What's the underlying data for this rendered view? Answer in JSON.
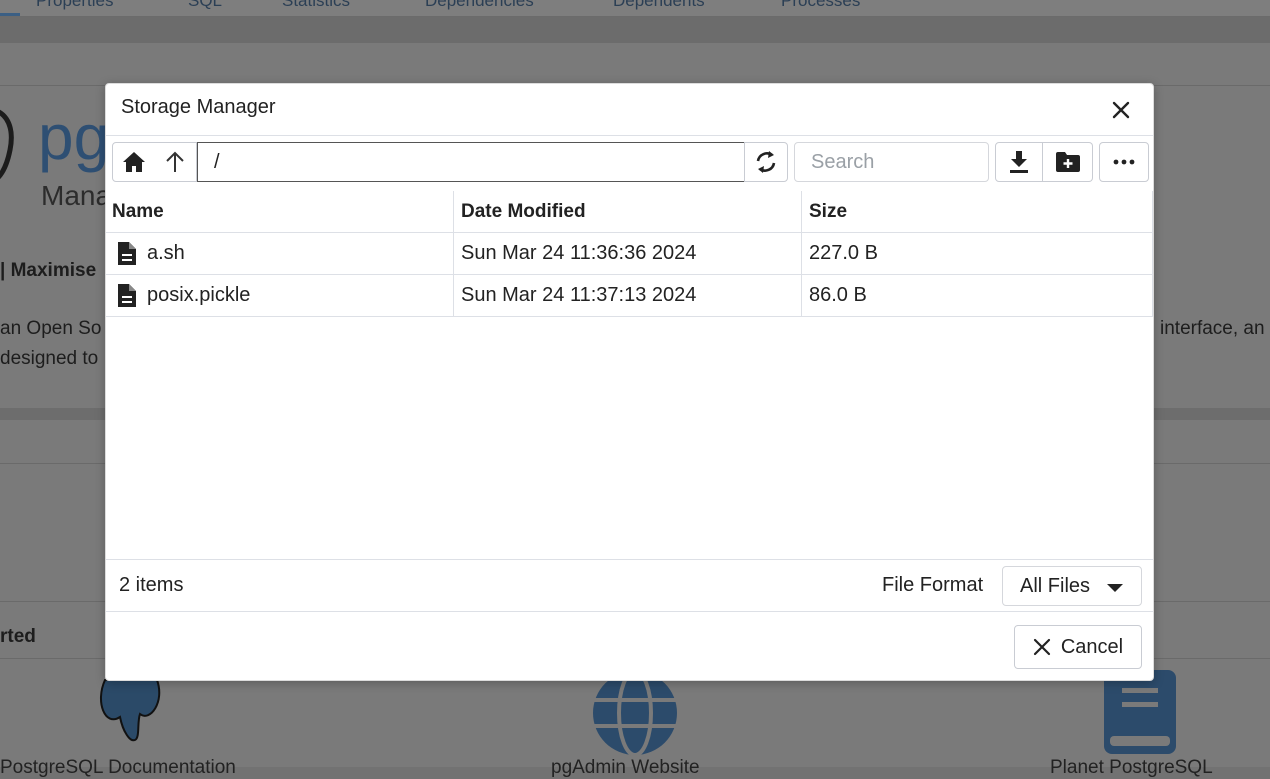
{
  "background": {
    "tabs": [
      "Properties",
      "SQL",
      "Statistics",
      "Dependencies",
      "Dependents",
      "Processes"
    ],
    "logo_text": "pg",
    "logo_subtext": "Mana",
    "feature_text": "| Maximise",
    "desc_left_1": "an Open So",
    "desc_left_2": "designed to",
    "desc_right": "interface, an",
    "section_title": "rted",
    "links": [
      "PostgreSQL Documentation",
      "pgAdmin Website",
      "Planet PostgreSQL"
    ]
  },
  "dialog": {
    "title": "Storage Manager",
    "path_value": "/",
    "search_placeholder": "Search",
    "columns": [
      "Name",
      "Date Modified",
      "Size"
    ],
    "files": [
      {
        "name": "a.sh",
        "modified": "Sun Mar 24 11:36:36 2024",
        "size": "227.0 B"
      },
      {
        "name": "posix.pickle",
        "modified": "Sun Mar 24 11:37:13 2024",
        "size": "86.0 B"
      }
    ],
    "items_count": "2 items",
    "file_format_label": "File Format",
    "file_format_value": "All Files",
    "cancel_label": "Cancel"
  },
  "colors": {
    "overlay": "#7a7a7a",
    "dialog_bg": "#ffffff",
    "border": "#dde0e6",
    "text": "#222222",
    "brand": "#2e4f73"
  }
}
